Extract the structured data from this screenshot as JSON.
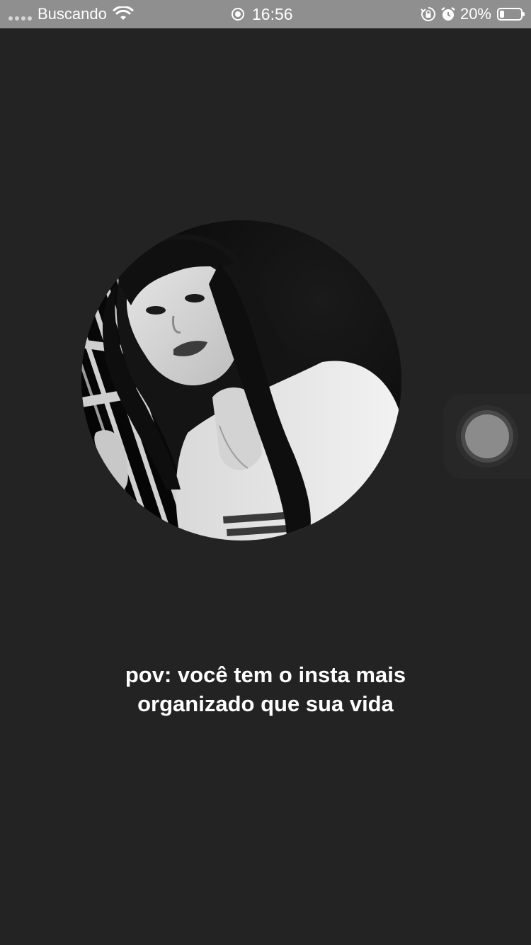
{
  "status_bar": {
    "carrier": "Buscando",
    "time": "16:56",
    "battery_percent": "20%",
    "battery_level": 0.2,
    "icons": [
      "signal-dots-icon",
      "wifi-icon",
      "focus-icon",
      "orientation-lock-icon",
      "alarm-icon",
      "battery-icon"
    ]
  },
  "content": {
    "caption": "pov: você tem o insta mais organizado que sua vida"
  },
  "colors": {
    "background": "#232323",
    "status_bar": "#8f8f8f",
    "caption_text": "#ffffff"
  }
}
